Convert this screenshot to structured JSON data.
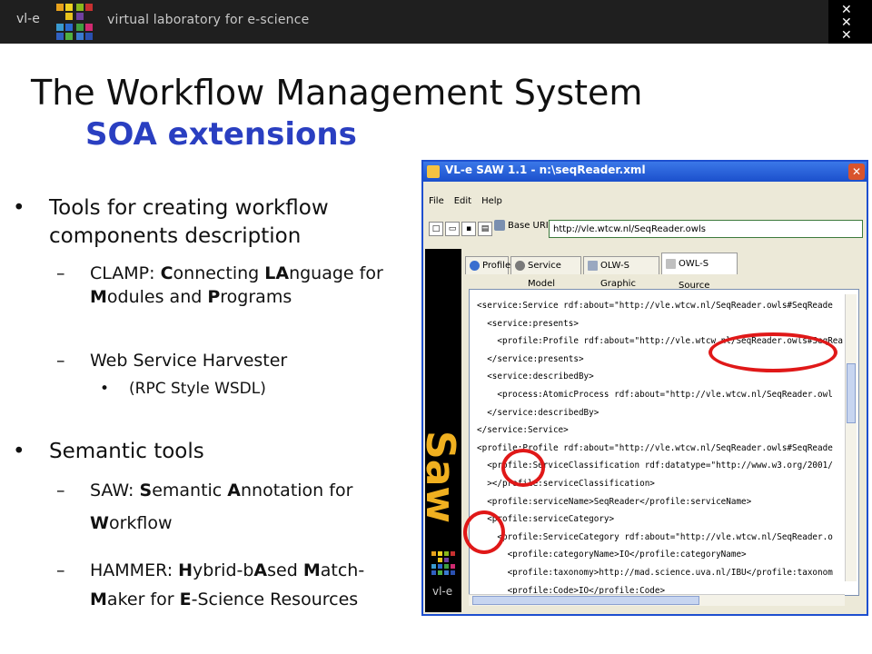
{
  "header": {
    "logo_text": "vl-e",
    "tagline": "virtual laboratory for e-science"
  },
  "slide": {
    "title": "The Workflow Management System",
    "subtitle": "SOA extensions",
    "bullet1": {
      "text": "Tools for creating workflow components description",
      "items": [
        {
          "segments": [
            "CLAMP: ",
            "C",
            "onnecting ",
            "LA",
            "nguage for ",
            "M",
            "odules and ",
            "P",
            "rograms"
          ]
        },
        {
          "text": "Web Service Harvester",
          "subitem": "(RPC Style WSDL)"
        }
      ]
    },
    "bullet2": {
      "text": "Semantic tools",
      "items": [
        {
          "segments": [
            "SAW: ",
            "S",
            "emantic ",
            "A",
            "nnotation for ",
            "W",
            "orkflow"
          ]
        },
        {
          "segments": [
            "HAMMER: ",
            "H",
            "ybrid-b",
            "A",
            "sed ",
            "M",
            "atch-",
            "M",
            "aker for ",
            "E",
            "-Science Resources"
          ]
        }
      ]
    }
  },
  "app": {
    "window_title": "VL-e SAW 1.1 - n:\\seqReader.xml",
    "menu": [
      "File",
      "Edit",
      "Help"
    ],
    "base_uri_label": "Base URI",
    "base_uri_value": "http://vle.wtcw.nl/SeqReader.owls",
    "side_label": "vl-e",
    "tabs": [
      "Profile",
      "Service Model",
      "OLW-S Graphic",
      "OWL-S Source"
    ],
    "active_tab": "OWL-S Source",
    "source_lines": [
      "<service:Service rdf:about=\"http://vle.wtcw.nl/SeqReader.owls#SeqReade",
      "  <service:presents>",
      "    <profile:Profile rdf:about=\"http://vle.wtcw.nl/SeqReader.owls#SeqRea",
      "  </service:presents>",
      "  <service:describedBy>",
      "    <process:AtomicProcess rdf:about=\"http://vle.wtcw.nl/SeqReader.owl",
      "  </service:describedBy>",
      "</service:Service>",
      "<profile:Profile rdf:about=\"http://vle.wtcw.nl/SeqReader.owls#SeqReade",
      "  <profile:ServiceClassification rdf:datatype=\"http://www.w3.org/2001/",
      "  ></profile:serviceClassification>",
      "  <profile:serviceName>SeqReader</profile:serviceName>",
      "  <profile:serviceCategory>",
      "    <profile:ServiceCategory rdf:about=\"http://vle.wtcw.nl/SeqReader.o",
      "      <profile:categoryName>IO</profile:categoryName>",
      "      <profile:taxonomy>http://mad.science.uva.nl/IBU</profile:taxonom",
      "      <profile:Code>IO</profile:Code>"
    ]
  },
  "colors": {
    "title": "#111111",
    "subtitle": "#2a3fc1",
    "highlight": "#e01818",
    "topbar": "#1f1f1f"
  }
}
